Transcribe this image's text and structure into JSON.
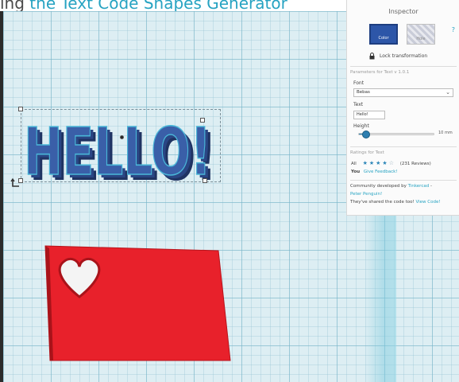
{
  "caption": {
    "prefix": "ing",
    "highlight": "the Text Code Shapes Generator"
  },
  "inspector": {
    "title": "Inspector",
    "help_label": "?",
    "color_swatch_label": "Color",
    "hole_swatch_label": "Hole",
    "lock_label": "Lock transformation",
    "params_heading": "Parameters for Text v 1.0.1",
    "font_label": "Font",
    "font_value": "Bebas",
    "text_label": "Text",
    "text_value": "Hello!",
    "height_label": "Height",
    "height_value": "10 mm",
    "height_fraction": 0.1,
    "ratings_heading": "Ratings for Text",
    "ratings_all_label": "All",
    "ratings_stars_filled": 4,
    "ratings_stars_total": 5,
    "ratings_reviews": "(231 Reviews)",
    "ratings_you_label": "You",
    "give_feedback": "Give Feedback!",
    "community_prefix": "Community developed by",
    "community_org": "Tinkercad",
    "community_author": "Peter Penguin!",
    "shared_text": "They've shared the code too!",
    "view_code": "View Code!"
  },
  "scene": {
    "hello_text": "HELLO!",
    "hello_color": "#3a5fa8",
    "hello_outline": "#49b6d8",
    "rect_color": "#e8212b",
    "workplane_color": "#ddeef3"
  },
  "icons": [
    "lock-icon",
    "chevron-down-icon",
    "rotate-icon",
    "heart-cutout-icon",
    "star-icon"
  ]
}
